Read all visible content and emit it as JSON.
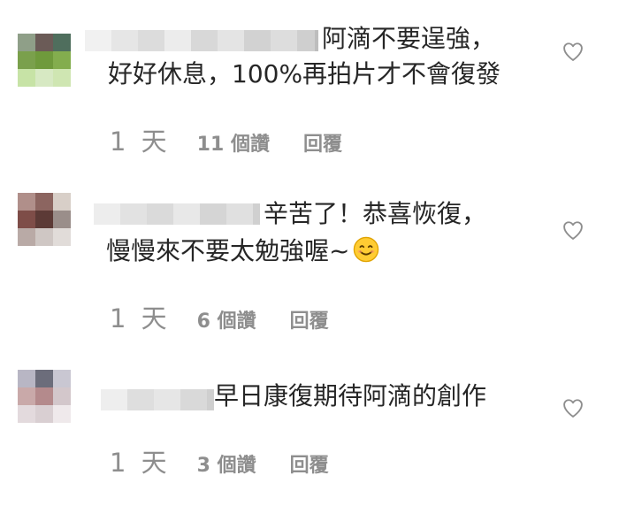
{
  "comments": [
    {
      "text_lines": [
        "阿滴不要逞強，",
        "好好休息，100%再拍片才不會復發"
      ],
      "time": "1 天",
      "likes": "11 個讚",
      "reply": "回覆",
      "icons": {
        "avatar": "avatar-pixelated",
        "like": "heart-outline-icon"
      }
    },
    {
      "text_lines": [
        "辛苦了！恭喜恢復，",
        "慢慢來不要太勉強喔~"
      ],
      "emoji": "smiling-face-emoji",
      "time": "1 天",
      "likes": "6 個讚",
      "reply": "回覆",
      "icons": {
        "avatar": "avatar-pixelated",
        "like": "heart-outline-icon"
      }
    },
    {
      "text_lines": [
        "早日康復期待阿滴的創作"
      ],
      "time": "1 天",
      "likes": "3 個讚",
      "reply": "回覆",
      "icons": {
        "avatar": "avatar-pixelated",
        "like": "heart-outline-icon"
      }
    }
  ]
}
